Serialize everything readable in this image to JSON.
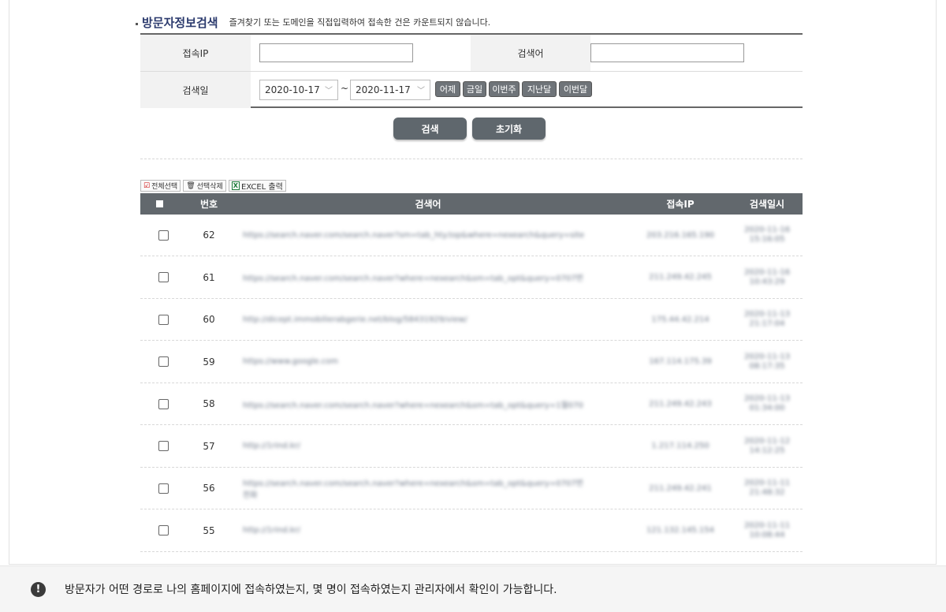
{
  "search": {
    "title": "방문자정보검색",
    "description": "즐겨찾기 또는 도메인을 직접입력하여 접속한 건은 카운트되지 않습니다.",
    "ip_label": "접속IP",
    "ip_value": "",
    "keyword_label": "검색어",
    "keyword_value": "",
    "date_label": "검색일",
    "date_from": "2020-10-17",
    "date_to": "2020-11-17",
    "tilde": "~",
    "quick_buttons": [
      "어제",
      "금일",
      "이번주",
      "지난달",
      "이번달"
    ],
    "search_button": "검색",
    "reset_button": "초기화"
  },
  "toolbar": {
    "select_all": "전체선택",
    "delete_selected": "선택삭제",
    "excel": "EXCEL 출력"
  },
  "table": {
    "headers": [
      "번호",
      "검색어",
      "접속IP",
      "검색일시"
    ],
    "rows": [
      {
        "no": "62",
        "keyword": "https://search.naver.com/search.naver?sm=tab_hty.top&where=nexearch&query=site",
        "ip": "203.216.165.190",
        "date": "2020-11-16",
        "time": "15:16:05"
      },
      {
        "no": "61",
        "keyword": "https://search.naver.com/search.naver?where=nexearch&sm=tab_opt&query=0707번",
        "ip": "211.249.42.245",
        "date": "2020-11-16",
        "time": "10:43:29"
      },
      {
        "no": "60",
        "keyword": "http://dicept.immobilierabgerie.net/blog/58431929/view/",
        "ip": "175.44.42.214",
        "date": "2020-11-13",
        "time": "21:17:04"
      },
      {
        "no": "59",
        "keyword": "https://www.google.com",
        "ip": "167.114.175.39",
        "date": "2020-11-13",
        "time": "08:17:35"
      },
      {
        "no": "58",
        "keyword": "https://search.naver.com/search.naver?where=nexearch&sm=tab_opt&query=1월070",
        "ip": "211.249.42.243",
        "date": "2020-11-13",
        "time": "01:34:00"
      },
      {
        "no": "57",
        "keyword": "http://1rind.kr/",
        "ip": "1.217.114.250",
        "date": "2020-11-12",
        "time": "14:12:25"
      },
      {
        "no": "56",
        "keyword": "https://search.naver.com/search.naver?where=nexearch&sm=tab_opt&query=0707번",
        "keyword2": "전화",
        "ip": "211.249.42.241",
        "date": "2020-11-11",
        "time": "21:48:32"
      },
      {
        "no": "55",
        "keyword": "http://1rind.kr/",
        "ip": "121.132.145.154",
        "date": "2020-11-11",
        "time": "10:08:44"
      }
    ]
  },
  "footer": {
    "icon": "exclamation-icon",
    "text": "방문자가 어떤 경로로 나의 홈페이지에 접속하였는지, 몇 명이 접속하였는지 관리자에서 확인이 가능합니다."
  },
  "colors": {
    "title": "#2c3b6e",
    "header_bg": "#62686d",
    "button_bg": "#5f676d"
  }
}
